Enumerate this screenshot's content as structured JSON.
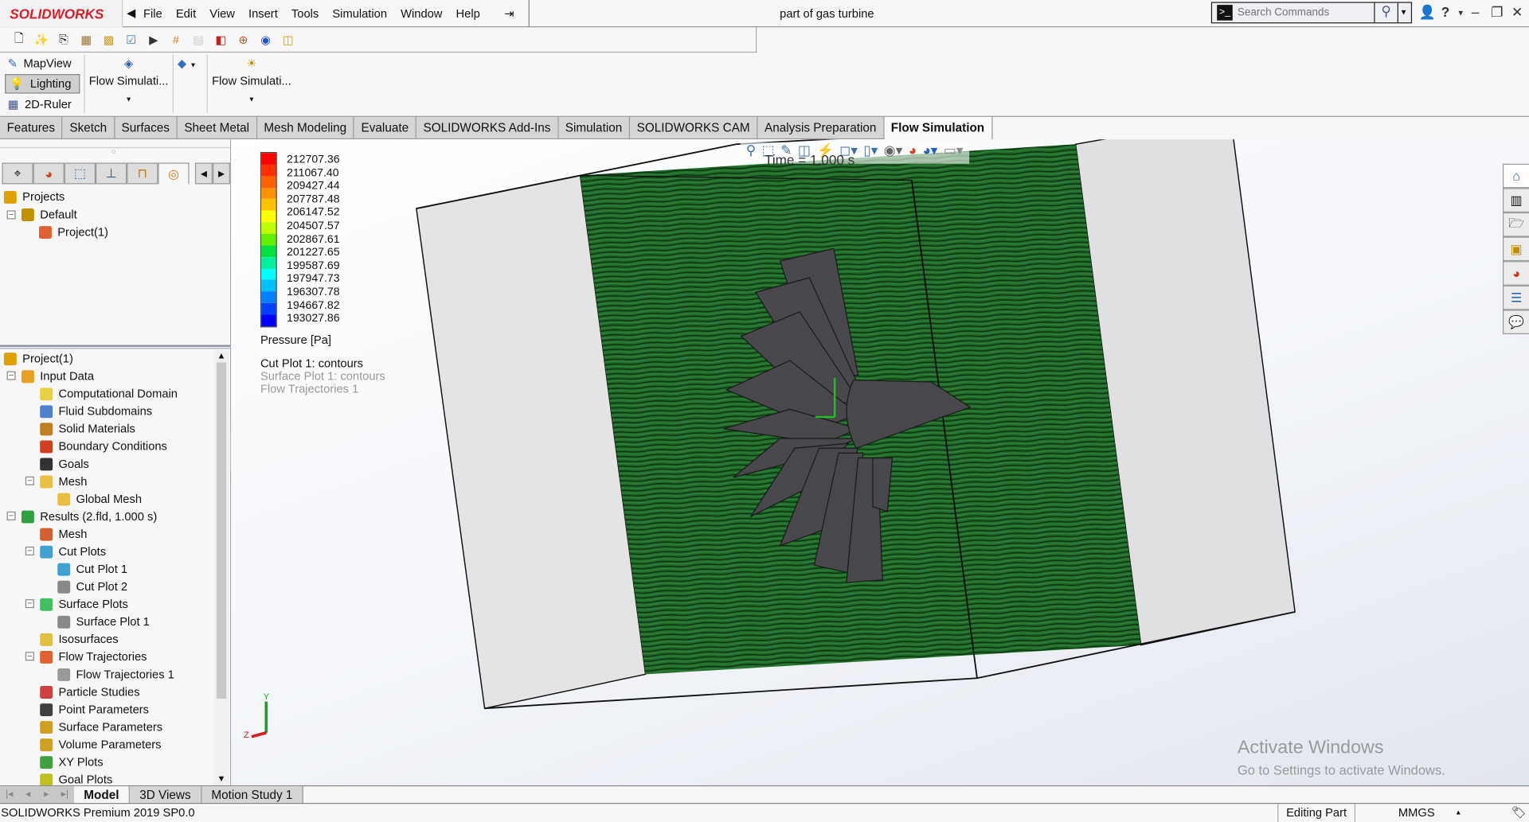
{
  "app": {
    "brand": "SOLIDWORKS",
    "document_title": "part of gas turbine"
  },
  "menu": [
    "File",
    "Edit",
    "View",
    "Insert",
    "Tools",
    "Simulation",
    "Window",
    "Help"
  ],
  "search": {
    "placeholder": "Search Commands"
  },
  "ribbon": {
    "mapview": "MapView",
    "lighting": "Lighting",
    "ruler": "2D-Ruler",
    "flow_sim_1": "Flow Simulati...",
    "flow_sim_2": "Flow Simulati..."
  },
  "tabs": [
    {
      "label": "Features"
    },
    {
      "label": "Sketch"
    },
    {
      "label": "Surfaces"
    },
    {
      "label": "Sheet Metal"
    },
    {
      "label": "Mesh Modeling"
    },
    {
      "label": "Evaluate"
    },
    {
      "label": "SOLIDWORKS Add-Ins"
    },
    {
      "label": "Simulation"
    },
    {
      "label": "SOLIDWORKS CAM"
    },
    {
      "label": "Analysis Preparation"
    },
    {
      "label": "Flow Simulation",
      "active": true
    }
  ],
  "projects_tree": [
    "Projects",
    "Default",
    "Project(1)"
  ],
  "analysis_tree": [
    {
      "label": "Project(1)",
      "level": 0,
      "color": "#e0a000"
    },
    {
      "label": "Input Data",
      "level": 1,
      "color": "#e8a020",
      "expand": "-"
    },
    {
      "label": "Computational Domain",
      "level": 2,
      "color": "#e8d040"
    },
    {
      "label": "Fluid Subdomains",
      "level": 2,
      "color": "#5080d0"
    },
    {
      "label": "Solid Materials",
      "level": 2,
      "color": "#c08020"
    },
    {
      "label": "Boundary Conditions",
      "level": 2,
      "color": "#d04020"
    },
    {
      "label": "Goals",
      "level": 2,
      "color": "#333333"
    },
    {
      "label": "Mesh",
      "level": 2,
      "color": "#e8c040",
      "expand": "-"
    },
    {
      "label": "Global Mesh",
      "level": 3,
      "color": "#e8c040"
    },
    {
      "label": "Results (2.fld, 1.000 s)",
      "level": 1,
      "color": "#30a040",
      "expand": "-"
    },
    {
      "label": "Mesh",
      "level": 2,
      "color": "#d06030"
    },
    {
      "label": "Cut Plots",
      "level": 2,
      "color": "#40a0d0",
      "expand": "-"
    },
    {
      "label": "Cut Plot 1",
      "level": 3,
      "color": "#40a0d0"
    },
    {
      "label": "Cut Plot 2",
      "level": 3,
      "color": "#888888"
    },
    {
      "label": "Surface Plots",
      "level": 2,
      "color": "#40c060",
      "expand": "-"
    },
    {
      "label": "Surface Plot 1",
      "level": 3,
      "color": "#888888"
    },
    {
      "label": "Isosurfaces",
      "level": 2,
      "color": "#e0c040"
    },
    {
      "label": "Flow Trajectories",
      "level": 2,
      "color": "#e06030",
      "expand": "-"
    },
    {
      "label": "Flow Trajectories 1",
      "level": 3,
      "color": "#999999"
    },
    {
      "label": "Particle Studies",
      "level": 2,
      "color": "#d04040"
    },
    {
      "label": "Point Parameters",
      "level": 2,
      "color": "#404040"
    },
    {
      "label": "Surface Parameters",
      "level": 2,
      "color": "#d0a020"
    },
    {
      "label": "Volume Parameters",
      "level": 2,
      "color": "#d0a020"
    },
    {
      "label": "XY Plots",
      "level": 2,
      "color": "#40a040"
    },
    {
      "label": "Goal Plots",
      "level": 2,
      "color": "#c0c020"
    }
  ],
  "legend": {
    "values": [
      "212707.36",
      "211067.40",
      "209427.44",
      "207787.48",
      "206147.52",
      "204507.57",
      "202867.61",
      "201227.65",
      "199587.69",
      "197947.73",
      "196307.78",
      "194667.82",
      "193027.86"
    ],
    "colors": [
      "#ff0000",
      "#ff3000",
      "#ff6000",
      "#ff9000",
      "#ffc000",
      "#ffff00",
      "#c0ff00",
      "#60f000",
      "#00e040",
      "#00f0a0",
      "#00ffff",
      "#00c0ff",
      "#0080ff",
      "#0040ff",
      "#0000ff"
    ],
    "unit_label": "Pressure [Pa]",
    "plots": [
      "Cut Plot 1: contours",
      "Surface Plot 1: contours",
      "Flow Trajectories 1"
    ],
    "time_label": "Time = 1.000 s"
  },
  "axes": {
    "y": "Y",
    "z": "Z"
  },
  "bottom_tabs": [
    {
      "label": "Model",
      "active": true
    },
    {
      "label": "3D Views"
    },
    {
      "label": "Motion Study 1"
    }
  ],
  "status": {
    "version": "SOLIDWORKS Premium 2019 SP0.0",
    "mode": "Editing Part",
    "units": "MMGS"
  },
  "watermark": {
    "title": "Activate Windows",
    "subtitle": "Go to Settings to activate Windows."
  }
}
